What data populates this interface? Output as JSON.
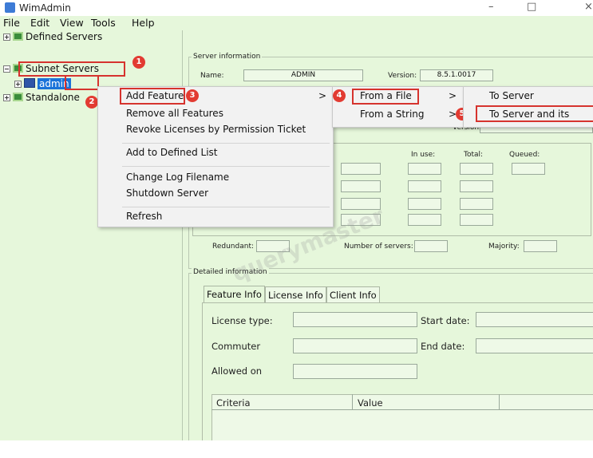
{
  "window": {
    "title": "WimAdmin",
    "minimize": "–",
    "maximize": "□",
    "close": "×"
  },
  "menubar": [
    "File",
    "Edit",
    "View",
    "Tools",
    "Help"
  ],
  "tree": {
    "defined": "Defined Servers",
    "subnet": "Subnet Servers",
    "admin": "admin",
    "standalone": "Standalone"
  },
  "badges": [
    "1",
    "2",
    "3",
    "4",
    "5"
  ],
  "context_menu": {
    "add_feature": "Add Feature",
    "remove_all": "Remove all Features",
    "revoke": "Revoke Licenses by Permission Ticket",
    "add_defined": "Add to Defined List",
    "change_log": "Change Log Filename",
    "shutdown": "Shutdown Server",
    "refresh": "Refresh",
    "arrow": ">"
  },
  "submenu1": {
    "from_file": "From a File",
    "from_string": "From a String",
    "arrow": ">"
  },
  "submenu2": {
    "to_server": "To Server",
    "to_server_and": "To Server and its"
  },
  "server_info": {
    "group": "Server information",
    "name_label": "Name:",
    "name_value": "ADMIN",
    "version_label": "Version:",
    "version_value": "8.5.1.0017",
    "version2_label": "Version:",
    "in_use": "In use:",
    "total": "Total:",
    "queued": "Queued:",
    "redundant": "Redundant:",
    "num_servers": "Number of servers:",
    "majority": "Majority:"
  },
  "detailed": {
    "group": "Detailed information",
    "tabs": [
      "Feature Info",
      "License Info",
      "Client Info"
    ],
    "license_type": "License type:",
    "commuter": "Commuter",
    "allowed_on": "Allowed on",
    "start_date": "Start date:",
    "end_date": "End date:",
    "col_criteria": "Criteria",
    "col_value": "Value"
  },
  "watermark": "querymaster"
}
